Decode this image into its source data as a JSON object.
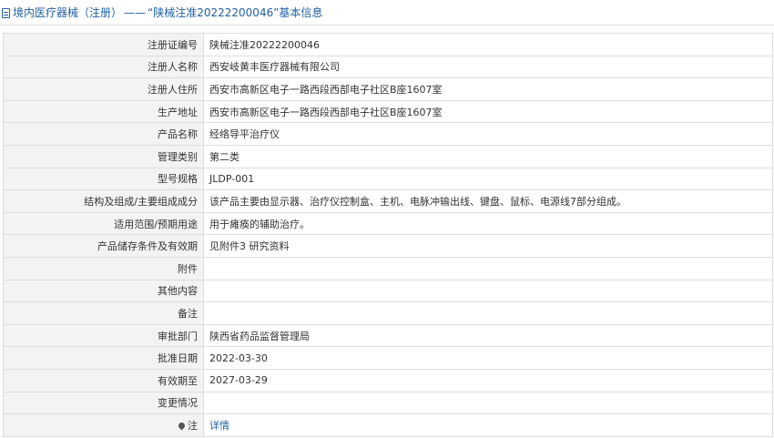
{
  "header": {
    "section": "境内医疗器械（注册）",
    "dash": "——",
    "title": "“陕械注准20222200046”基本信息"
  },
  "rows": [
    {
      "label": "注册证编号",
      "value": "陕械注准20222200046"
    },
    {
      "label": "注册人名称",
      "value": "西安岐黄丰医疗器械有限公司"
    },
    {
      "label": "注册人住所",
      "value": "西安市高新区电子一路西段西部电子社区B座1607室"
    },
    {
      "label": "生产地址",
      "value": "西安市高新区电子一路西段西部电子社区B座1607室"
    },
    {
      "label": "产品名称",
      "value": "经络导平治疗仪"
    },
    {
      "label": "管理类别",
      "value": "第二类"
    },
    {
      "label": "型号规格",
      "value": "JLDP-001"
    },
    {
      "label": "结构及组成/主要组成成分",
      "value": "该产品主要由显示器、治疗仪控制盒、主机、电脉冲输出线、键盘、鼠标、电源线7部分组成。"
    },
    {
      "label": "适用范围/预期用途",
      "value": "用于瘫痪的辅助治疗。"
    },
    {
      "label": "产品储存条件及有效期",
      "value": "见附件3 研究资料"
    },
    {
      "label": "附件",
      "value": ""
    },
    {
      "label": "其他内容",
      "value": ""
    },
    {
      "label": "备注",
      "value": ""
    },
    {
      "label": "审批部门",
      "value": "陕西省药品监督管理局"
    },
    {
      "label": "批准日期",
      "value": "2022-03-30"
    },
    {
      "label": "有效期至",
      "value": "2027-03-29"
    },
    {
      "label": "变更情况",
      "value": ""
    }
  ],
  "note_row": {
    "label": "注",
    "link": "详情"
  }
}
